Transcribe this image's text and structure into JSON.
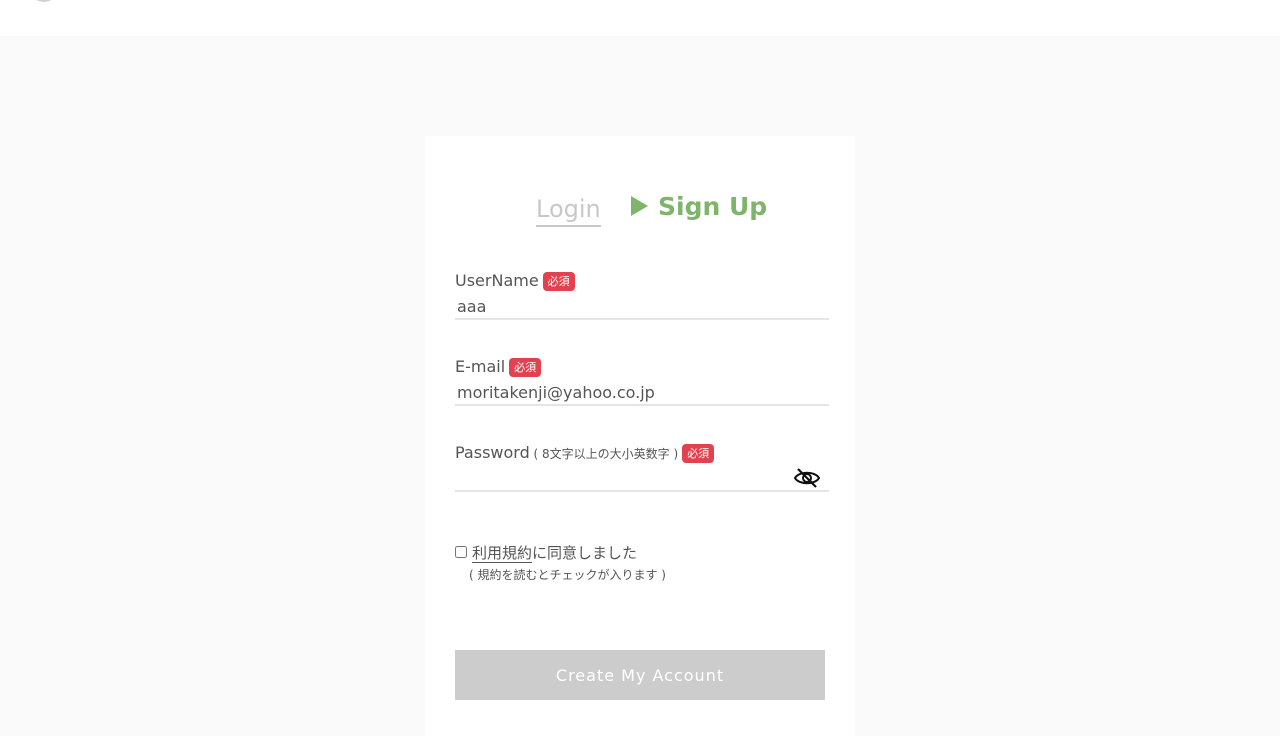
{
  "tabs": {
    "login_label": "Login",
    "signup_label": "Sign Up",
    "active": "Sign Up"
  },
  "form": {
    "username": {
      "label": "UserName",
      "badge": "必須",
      "value": "aaa"
    },
    "email": {
      "label": "E-mail",
      "badge": "必須",
      "value": "moritakenji@yahoo.co.jp"
    },
    "password": {
      "label": "Password",
      "note": " ( 8文字以上の大小英数字 )",
      "badge": "必須",
      "value": "",
      "toggle_icon": "eye-off-icon"
    },
    "agree": {
      "terms_link": "利用規約",
      "text": "に同意しました",
      "hint": "( 規約を読むとチェックが入ります )",
      "checked": false
    },
    "submit_label": "Create My Account"
  },
  "colors": {
    "accent_green": "#7fb46b",
    "badge_red": "#e2414f",
    "button_disabled": "#cccccc",
    "background": "#fafafa"
  }
}
